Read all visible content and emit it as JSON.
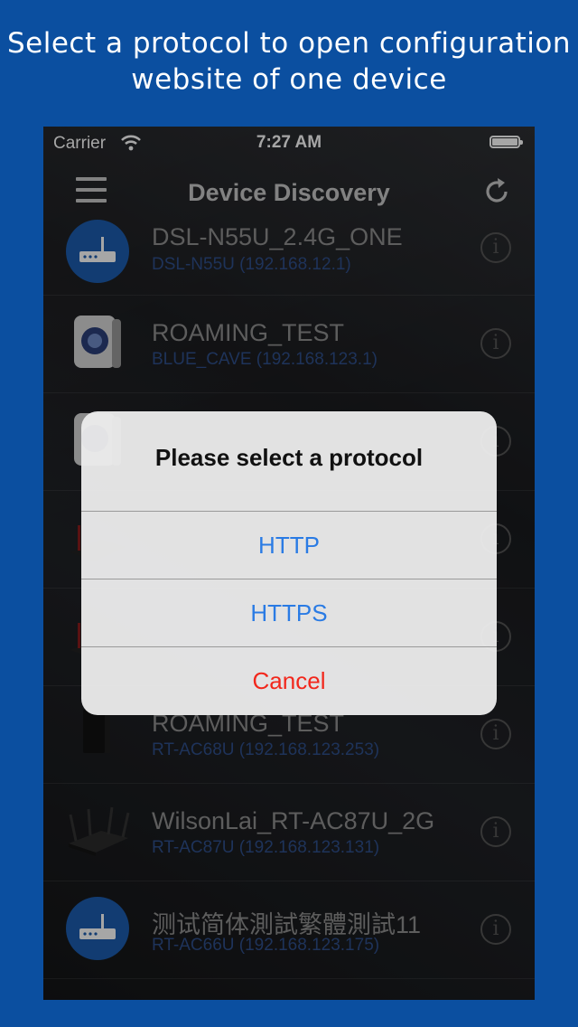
{
  "caption": {
    "line1": "Select a protocol to open configuration",
    "line2": "website of one device"
  },
  "status_bar": {
    "carrier": "Carrier",
    "time": "7:27 AM",
    "wifi_icon": "wifi-icon",
    "battery_icon": "battery-icon"
  },
  "nav": {
    "title": "Device Discovery",
    "menu_icon": "menu-icon",
    "refresh_icon": "refresh-icon"
  },
  "devices": [
    {
      "name": "DSL-N55U_2.4G_ONE",
      "sub": "DSL-N55U (192.168.12.1)",
      "icon": "router-round-icon"
    },
    {
      "name": "ROAMING_TEST",
      "sub": "BLUE_CAVE (192.168.123.1)",
      "icon": "blue-cave-icon"
    },
    {
      "name": "",
      "sub": "",
      "icon": "blue-cave-icon"
    },
    {
      "name": "",
      "sub": "",
      "icon": "router-icon"
    },
    {
      "name": "",
      "sub": "",
      "icon": "router-icon"
    },
    {
      "name": "ROAMING_TEST",
      "sub": "RT-AC68U (192.168.123.253)",
      "icon": "router-icon"
    },
    {
      "name": "WilsonLai_RT-AC87U_2G",
      "sub": "RT-AC87U (192.168.123.131)",
      "icon": "router-antenna-icon"
    },
    {
      "name": "测试简体測試繁體測試11",
      "sub": "RT-AC66U (192.168.123.175)",
      "icon": "router-round-icon"
    }
  ],
  "alert": {
    "title": "Please select a protocol",
    "buttons": [
      "HTTP",
      "HTTPS",
      "Cancel"
    ]
  },
  "colors": {
    "background": "#0b4fa0",
    "link": "#2a7be4",
    "cancel": "#f2271c"
  }
}
